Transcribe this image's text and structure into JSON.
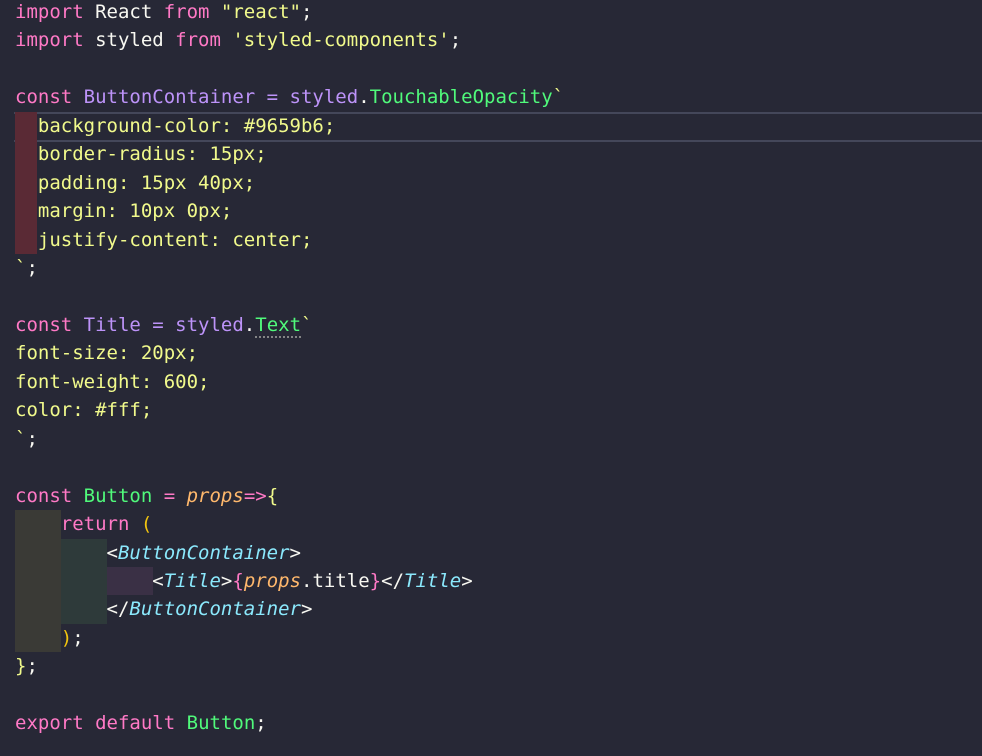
{
  "editor": {
    "background": "#272836",
    "lines": [
      {
        "tokens": [
          {
            "t": "import",
            "c": "tok-keyword"
          },
          {
            "t": " React ",
            "c": "tok-plain"
          },
          {
            "t": "from",
            "c": "tok-keyword"
          },
          {
            "t": " \"react\"",
            "c": "tok-string"
          },
          {
            "t": ";",
            "c": "tok-plain"
          }
        ]
      },
      {
        "tokens": [
          {
            "t": "import",
            "c": "tok-keyword"
          },
          {
            "t": " styled ",
            "c": "tok-plain"
          },
          {
            "t": "from",
            "c": "tok-keyword"
          },
          {
            "t": " 'styled-components'",
            "c": "tok-string"
          },
          {
            "t": ";",
            "c": "tok-plain"
          }
        ]
      },
      {
        "tokens": []
      },
      {
        "tokens": [
          {
            "t": "const",
            "c": "tok-keyword"
          },
          {
            "t": " ButtonContainer = ",
            "c": "tok-purple"
          },
          {
            "t": "styled",
            "c": "tok-purple"
          },
          {
            "t": ".",
            "c": "tok-plain"
          },
          {
            "t": "TouchableOpacity",
            "c": "tok-green"
          },
          {
            "t": "`",
            "c": "tok-string"
          }
        ]
      },
      {
        "tokens": [
          {
            "t": "  background-color: #9659b6;",
            "c": "tok-css"
          }
        ]
      },
      {
        "tokens": [
          {
            "t": "  border-radius: 15px;",
            "c": "tok-css"
          }
        ]
      },
      {
        "tokens": [
          {
            "t": "  padding: 15px 40px;",
            "c": "tok-css"
          }
        ]
      },
      {
        "tokens": [
          {
            "t": "  margin: 10px 0px;",
            "c": "tok-css"
          }
        ]
      },
      {
        "tokens": [
          {
            "t": "  justify-content: center;",
            "c": "tok-css"
          }
        ]
      },
      {
        "tokens": [
          {
            "t": "`",
            "c": "tok-string"
          },
          {
            "t": ";",
            "c": "tok-plain"
          }
        ]
      },
      {
        "tokens": []
      },
      {
        "tokens": [
          {
            "t": "const",
            "c": "tok-keyword"
          },
          {
            "t": " Title = ",
            "c": "tok-purple"
          },
          {
            "t": "styled",
            "c": "tok-purple"
          },
          {
            "t": ".",
            "c": "tok-plain"
          },
          {
            "t": "Text",
            "c": "tok-green dotted"
          },
          {
            "t": "`",
            "c": "tok-string"
          }
        ]
      },
      {
        "tokens": [
          {
            "t": "font-size: 20px;",
            "c": "tok-css"
          }
        ]
      },
      {
        "tokens": [
          {
            "t": "font-weight: 600;",
            "c": "tok-css"
          }
        ]
      },
      {
        "tokens": [
          {
            "t": "color: #fff;",
            "c": "tok-css"
          }
        ]
      },
      {
        "tokens": [
          {
            "t": "`",
            "c": "tok-string"
          },
          {
            "t": ";",
            "c": "tok-plain"
          }
        ]
      },
      {
        "tokens": []
      },
      {
        "tokens": [
          {
            "t": "const",
            "c": "tok-keyword"
          },
          {
            "t": " Button ",
            "c": "tok-green"
          },
          {
            "t": "= ",
            "c": "tok-keyword"
          },
          {
            "t": "props",
            "c": "tok-italic-orange"
          },
          {
            "t": "=>",
            "c": "tok-arrow"
          },
          {
            "t": "{",
            "c": "tok-brace"
          }
        ]
      },
      {
        "tokens": [
          {
            "t": "    ",
            "c": "tok-plain"
          },
          {
            "t": "return",
            "c": "tok-keyword"
          },
          {
            "t": " ",
            "c": "tok-plain"
          },
          {
            "t": "(",
            "c": "tok-paren"
          }
        ]
      },
      {
        "tokens": [
          {
            "t": "        <",
            "c": "tok-tag-bracket"
          },
          {
            "t": "ButtonContainer",
            "c": "tok-component"
          },
          {
            "t": ">",
            "c": "tok-tag-bracket"
          }
        ]
      },
      {
        "tokens": [
          {
            "t": "            <",
            "c": "tok-tag-bracket"
          },
          {
            "t": "Title",
            "c": "tok-component"
          },
          {
            "t": ">",
            "c": "tok-tag-bracket"
          },
          {
            "t": "{",
            "c": "tok-jsx-brace"
          },
          {
            "t": "props",
            "c": "tok-italic-orange"
          },
          {
            "t": ".title",
            "c": "tok-prop"
          },
          {
            "t": "}",
            "c": "tok-jsx-brace"
          },
          {
            "t": "</",
            "c": "tok-tag-bracket"
          },
          {
            "t": "Title",
            "c": "tok-component"
          },
          {
            "t": ">",
            "c": "tok-tag-bracket"
          }
        ]
      },
      {
        "tokens": [
          {
            "t": "        </",
            "c": "tok-tag-bracket"
          },
          {
            "t": "ButtonContainer",
            "c": "tok-component"
          },
          {
            "t": ">",
            "c": "tok-tag-bracket"
          }
        ]
      },
      {
        "tokens": [
          {
            "t": "    ",
            "c": "tok-plain"
          },
          {
            "t": ")",
            "c": "tok-paren"
          },
          {
            "t": ";",
            "c": "tok-plain"
          }
        ]
      },
      {
        "tokens": [
          {
            "t": "}",
            "c": "tok-brace"
          },
          {
            "t": ";",
            "c": "tok-plain"
          }
        ]
      },
      {
        "tokens": []
      },
      {
        "tokens": [
          {
            "t": "export",
            "c": "tok-keyword"
          },
          {
            "t": " ",
            "c": "tok-plain"
          },
          {
            "t": "default",
            "c": "tok-keyword"
          },
          {
            "t": " ",
            "c": "tok-plain"
          },
          {
            "t": "Button",
            "c": "tok-green"
          },
          {
            "t": ";",
            "c": "tok-plain"
          }
        ]
      }
    ]
  },
  "indent_guides": {
    "css_block_color": "#5a2a35",
    "level1_color": "#3a3a36",
    "level2_color": "#2e3a3a",
    "level3_color": "#3a3045"
  }
}
